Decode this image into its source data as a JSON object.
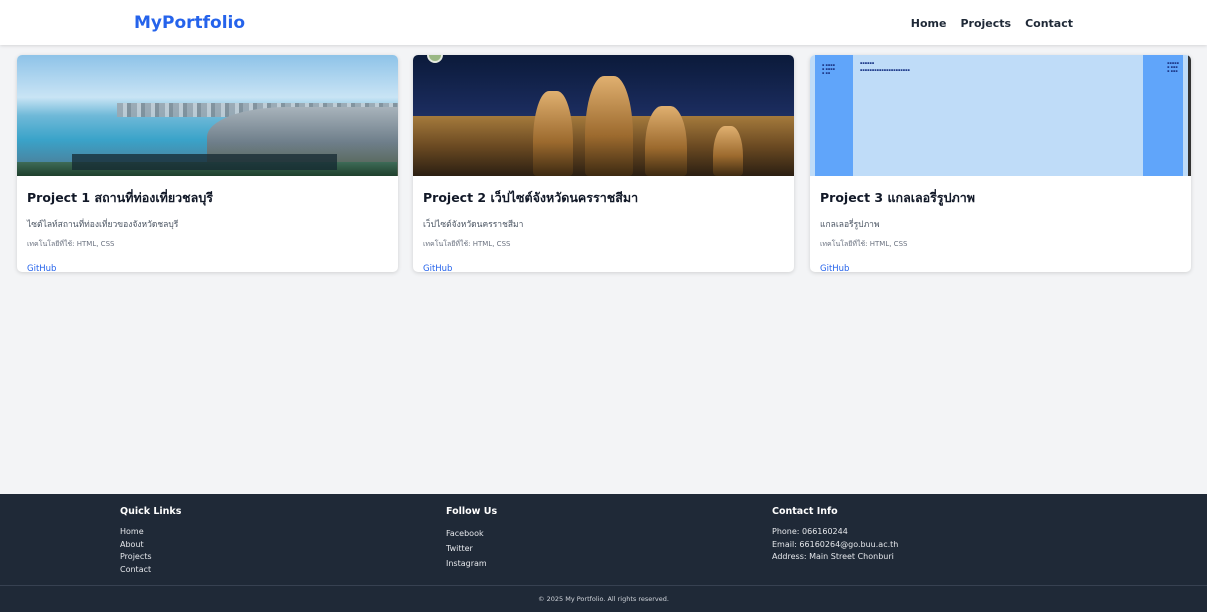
{
  "header": {
    "brand": "MyPortfolio",
    "nav": [
      "Home",
      "Projects",
      "Contact"
    ]
  },
  "projects": [
    {
      "title": "Project 1 สถานที่ท่องเที่ยวชลบุรี",
      "description": "ไซต์ไลท์สถานที่ท่องเที่ยวของจังหวัดชลบุรี",
      "tech": "เทคโนโลยีที่ใช้: HTML, CSS",
      "link": "GitHub",
      "image_icon": "coast-city-photo"
    },
    {
      "title": "Project 2 เว็ปไซต์จังหวัดนครราชสีมา",
      "description": "เว็ปไซต์จังหวัดนครราชสีมา",
      "tech": "เทคโนโลยีที่ใช้: HTML, CSS",
      "link": "GitHub",
      "image_icon": "temple-night-photo"
    },
    {
      "title": "Project 3 แกลเลอรี่รูปภาพ",
      "description": "แกลเลอรี่รูปภาพ",
      "tech": "เทคโนโลยีที่ใช้: HTML, CSS",
      "link": "GitHub",
      "image_icon": "gallery-page-screenshot"
    }
  ],
  "footer": {
    "quick_links": {
      "title": "Quick Links",
      "items": [
        "Home",
        "About",
        "Projects",
        "Contact"
      ]
    },
    "follow": {
      "title": "Follow Us",
      "items": [
        "Facebook",
        "Twitter",
        "Instagram"
      ]
    },
    "contact": {
      "title": "Contact Info",
      "phone": "Phone: 066160244",
      "email": "Email: 66160264@go.buu.ac.th",
      "address": "Address: Main Street Chonburi"
    },
    "copyright": "© 2025 My Portfolio. All rights reserved."
  },
  "colors": {
    "brand": "#2563eb",
    "footer_bg": "#1f2937",
    "page_bg": "#f3f4f6"
  }
}
